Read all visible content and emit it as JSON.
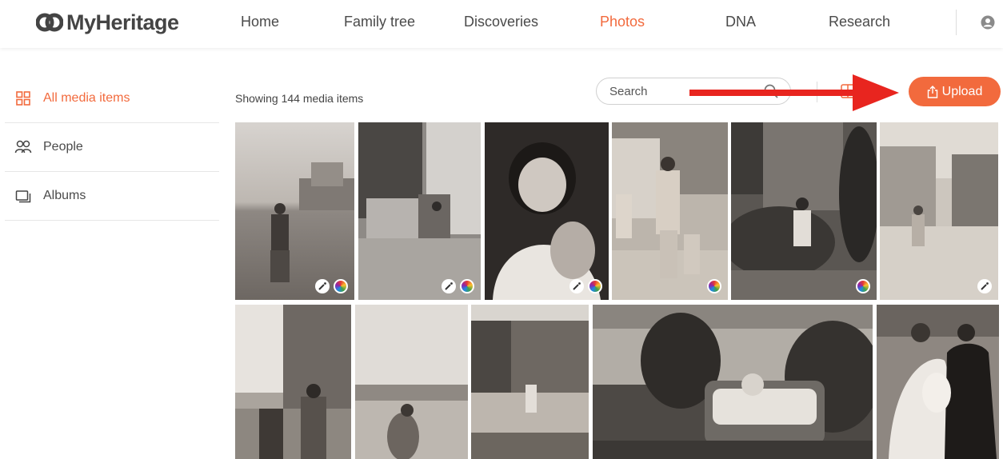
{
  "header": {
    "logo_text": "MyHeritage",
    "nav": [
      {
        "label": "Home"
      },
      {
        "label": "Family tree"
      },
      {
        "label": "Discoveries"
      },
      {
        "label": "Photos"
      },
      {
        "label": "DNA"
      },
      {
        "label": "Research"
      }
    ],
    "active_nav": "Photos"
  },
  "sidebar": {
    "items": [
      {
        "label": "All media items",
        "icon": "grid-icon"
      },
      {
        "label": "People",
        "icon": "people-icon"
      },
      {
        "label": "Albums",
        "icon": "albums-icon"
      }
    ]
  },
  "toolbar": {
    "count_text": "Showing 144 media items",
    "search_placeholder": "Search",
    "upload_label": "Upload"
  },
  "colors": {
    "accent": "#f26a3d",
    "arrow": "#e8251f"
  },
  "photos": [
    {
      "id": 1,
      "badges": [
        "enhance",
        "color"
      ]
    },
    {
      "id": 2,
      "badges": [
        "enhance",
        "color"
      ]
    },
    {
      "id": 3,
      "badges": [
        "enhance",
        "color"
      ]
    },
    {
      "id": 4,
      "badges": [
        "color"
      ]
    },
    {
      "id": 5,
      "badges": [
        "color"
      ]
    },
    {
      "id": 6,
      "badges": [
        "enhance"
      ]
    },
    {
      "id": 7,
      "badges": []
    },
    {
      "id": 8,
      "badges": []
    },
    {
      "id": 9,
      "badges": []
    },
    {
      "id": 10,
      "badges": []
    },
    {
      "id": 11,
      "badges": []
    }
  ]
}
